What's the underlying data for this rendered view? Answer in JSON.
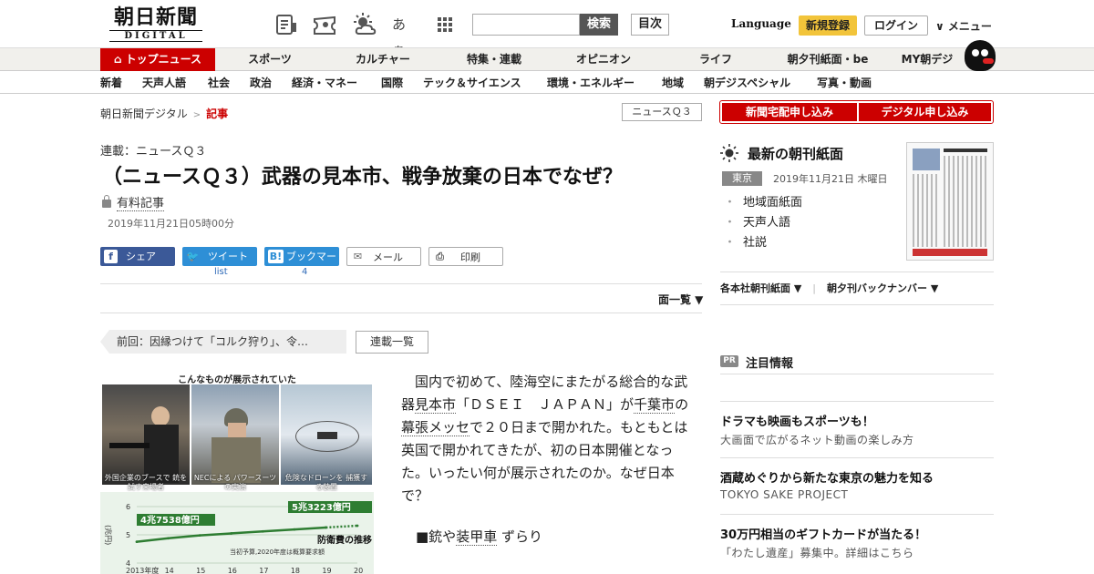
{
  "header": {
    "logo_kanji": "朝日新聞",
    "logo_sub": "DIGITAL",
    "font_icon_label": "あぁ",
    "search_placeholder": "",
    "search_button": "検索",
    "contents_button": "目次",
    "language": "Language",
    "register": "新規登録",
    "login": "ログイン",
    "menu": "∨ メニュー"
  },
  "nav_primary": [
    {
      "label": "トップニュース",
      "active": true
    },
    {
      "label": "スポーツ"
    },
    {
      "label": "カルチャー"
    },
    {
      "label": "特集・連載"
    },
    {
      "label": "オピニオン"
    },
    {
      "label": "ライフ"
    },
    {
      "label": "朝夕刊紙面・be"
    },
    {
      "label": "MY朝デジ"
    }
  ],
  "nav_secondary": [
    "新着",
    "天声人語",
    "社会",
    "政治",
    "経済・マネー",
    "国際",
    "テック＆サイエンス",
    "環境・エネルギー",
    "地域",
    "朝デジスペシャル",
    "写真・動画"
  ],
  "breadcrumb": {
    "home": "朝日新聞デジタル",
    "sep": ">",
    "current": "記事"
  },
  "series_tag": "ニュースＱ３",
  "article": {
    "series": "連載：ニュースＱ３",
    "title": "（ニュースＱ３）武器の見本市、戦争放棄の日本でなぜ？",
    "paid": "有料記事",
    "date": "2019年11月21日05時00分",
    "share": {
      "facebook": "シェア",
      "twitter": "ツイート",
      "twitter_count": "list",
      "hatena": "ブックマーク",
      "hatena_count": "4",
      "mail": "メール",
      "print": "印刷"
    },
    "page_list": "面一覧 ▼",
    "prev": "前回：因縁つけて「コルク狩り」、令…",
    "all_series": "連載一覧",
    "figure": {
      "title": "こんなものが展示されていた",
      "captions": [
        "外国企業のブースで 銃を試す来場者",
        "NECによる パワースーツの実演",
        "危険なドローンを 捕獲する装置"
      ],
      "chart_label_start": "4兆7538億円",
      "chart_label_end": "5兆3223億円",
      "chart_title": "防衛費の推移",
      "chart_note": "当初予算,2020年度は概算要求額",
      "y_unit": "(兆円)",
      "y_ticks": [
        "6",
        "5",
        "4"
      ],
      "x_ticks": [
        "2013年度",
        "14",
        "15",
        "16",
        "17",
        "18",
        "19",
        "20"
      ]
    },
    "body_p1_a": "国内で初めて、陸海空にまたがる総合的な武器",
    "body_p1_link1": "見本市",
    "body_p1_b": "「ＤＳＥＩ　ＪＡＰＡＮ」が",
    "body_p1_link2": "千葉市",
    "body_p1_c": "の",
    "body_p1_link3": "幕張メッセ",
    "body_p1_d": "で２０日まで開かれた。もともとは英国で開かれてきたが、初の日本開催となった。いったい何が展示されたのか。なぜ日本で？",
    "sub_a": "■銃や",
    "sub_link": "装甲車",
    "sub_b": "ずらり"
  },
  "chart_data": {
    "type": "line",
    "title": "防衛費の推移",
    "x": [
      "2013年度",
      "14",
      "15",
      "16",
      "17",
      "18",
      "19",
      "20"
    ],
    "series": [
      {
        "values": [
          4.7538,
          4.88,
          4.98,
          5.05,
          5.12,
          5.19,
          5.26,
          5.3223
        ]
      }
    ],
    "ylabel": "(兆円)",
    "ylim": [
      4,
      6
    ],
    "annotations": [
      "4兆7538億円",
      "5兆3223億円",
      "当初予算,2020年度は概算要求額"
    ],
    "colors": [
      "#2e7d32"
    ]
  },
  "right": {
    "subscribe_paper": "新聞宅配申し込み",
    "subscribe_digital": "デジタル申し込み",
    "latest_title": "最新の朝刊紙面",
    "region": "東京",
    "date": "2019年11月21日 木曜日",
    "links": [
      "地域面紙面",
      "天声人語",
      "社説"
    ],
    "more1": "各本社朝刊紙面 ▼",
    "more2": "朝夕刊バックナンバー ▼",
    "pr_badge": "PR",
    "pr_title": "注目情報",
    "promos": [
      {
        "head": "ドラマも映画もスポーツも！",
        "sub": "大画面で広がるネット動画の楽しみ方"
      },
      {
        "head": "酒蔵めぐりから新たな東京の魅力を知る",
        "sub": "TOKYO SAKE PROJECT"
      },
      {
        "head": "30万円相当のギフトカードが当たる！",
        "sub": "「わたし遺産」募集中。詳細はこちら"
      }
    ]
  },
  "colors": {
    "brand_red": "#cc0000",
    "register_yellow": "#f2c43a",
    "facebook": "#3b5998",
    "twitter": "#2e8fd6"
  }
}
